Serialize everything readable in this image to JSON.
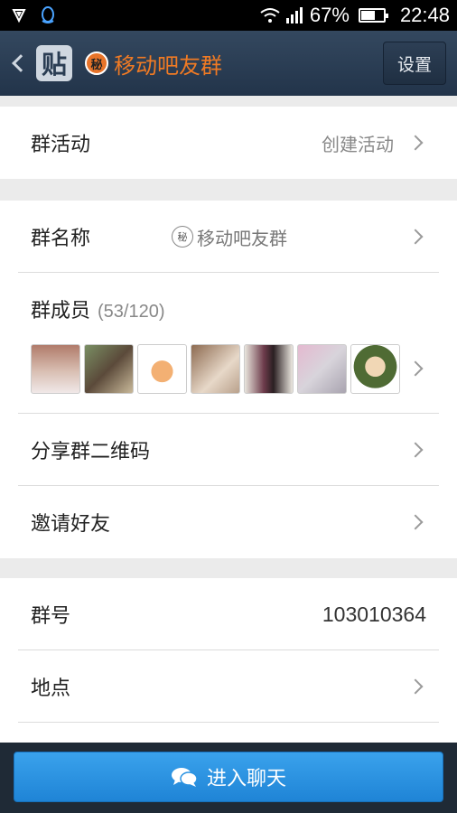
{
  "status_bar": {
    "battery": "67%",
    "battery_level": 0.67,
    "time": "22:48"
  },
  "header": {
    "logo_char": "贴",
    "badge_char": "秘",
    "title": "移动吧友群",
    "settings_label": "设置"
  },
  "sections": {
    "activity": {
      "label": "群活动",
      "action": "创建活动"
    },
    "group_name": {
      "label": "群名称",
      "badge_char": "秘",
      "value": "移动吧友群"
    },
    "members": {
      "label": "群成员",
      "count": "(53/120)"
    },
    "share_qr": {
      "label": "分享群二维码"
    },
    "invite": {
      "label": "邀请好友"
    },
    "group_id": {
      "label": "群号",
      "value": "103010364"
    },
    "location": {
      "label": "地点"
    }
  },
  "bottom": {
    "enter_chat_label": "进入聊天"
  },
  "colors": {
    "header_bg": "#2a3d53",
    "title_accent": "#ef7a24",
    "button_blue": "#2a93e2"
  }
}
